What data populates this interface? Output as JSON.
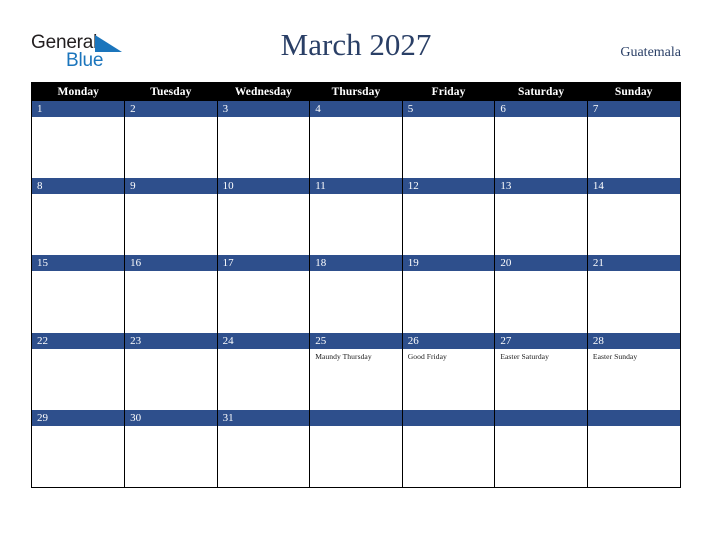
{
  "brand": {
    "name_part1": "General",
    "name_part2": "Blue",
    "triangle_icon": "blue-triangle-icon",
    "color_dark": "#231f20",
    "color_blue": "#1b75bc"
  },
  "header": {
    "title": "March 2027",
    "month": "March",
    "year": "2027",
    "country": "Guatemala",
    "title_color": "#2a3f66"
  },
  "theme": {
    "weekday_header_bg": "#000000",
    "weekday_header_text": "#ffffff",
    "day_bar_bg": "#2e4f8c",
    "day_number_text": "#ffffff",
    "cell_bg": "#ffffff",
    "grid_line": "#000000"
  },
  "weekday_headers": [
    "Monday",
    "Tuesday",
    "Wednesday",
    "Thursday",
    "Friday",
    "Saturday",
    "Sunday"
  ],
  "weeks": [
    [
      {
        "day": "1",
        "events": []
      },
      {
        "day": "2",
        "events": []
      },
      {
        "day": "3",
        "events": []
      },
      {
        "day": "4",
        "events": []
      },
      {
        "day": "5",
        "events": []
      },
      {
        "day": "6",
        "events": []
      },
      {
        "day": "7",
        "events": []
      }
    ],
    [
      {
        "day": "8",
        "events": []
      },
      {
        "day": "9",
        "events": []
      },
      {
        "day": "10",
        "events": []
      },
      {
        "day": "11",
        "events": []
      },
      {
        "day": "12",
        "events": []
      },
      {
        "day": "13",
        "events": []
      },
      {
        "day": "14",
        "events": []
      }
    ],
    [
      {
        "day": "15",
        "events": []
      },
      {
        "day": "16",
        "events": []
      },
      {
        "day": "17",
        "events": []
      },
      {
        "day": "18",
        "events": []
      },
      {
        "day": "19",
        "events": []
      },
      {
        "day": "20",
        "events": []
      },
      {
        "day": "21",
        "events": []
      }
    ],
    [
      {
        "day": "22",
        "events": []
      },
      {
        "day": "23",
        "events": []
      },
      {
        "day": "24",
        "events": []
      },
      {
        "day": "25",
        "events": [
          "Maundy Thursday"
        ]
      },
      {
        "day": "26",
        "events": [
          "Good Friday"
        ]
      },
      {
        "day": "27",
        "events": [
          "Easter Saturday"
        ]
      },
      {
        "day": "28",
        "events": [
          "Easter Sunday"
        ]
      }
    ],
    [
      {
        "day": "29",
        "events": []
      },
      {
        "day": "30",
        "events": []
      },
      {
        "day": "31",
        "events": []
      },
      {
        "day": "",
        "events": []
      },
      {
        "day": "",
        "events": []
      },
      {
        "day": "",
        "events": []
      },
      {
        "day": "",
        "events": []
      }
    ]
  ]
}
